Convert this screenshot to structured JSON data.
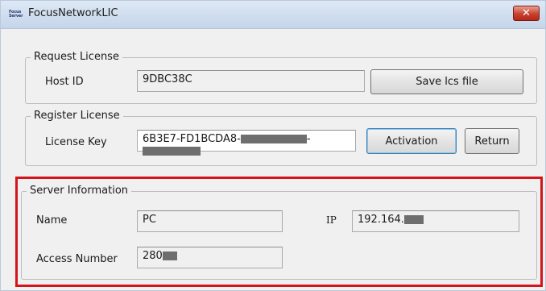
{
  "window": {
    "title": "FocusNetworkLIC",
    "app_icon_line1": "Focus",
    "app_icon_line2": "Server",
    "close_symbol": "✕"
  },
  "request_license": {
    "legend": "Request License",
    "host_id_label": "Host ID",
    "host_id_value": "9DBC38C",
    "save_button_label": "Save lcs file"
  },
  "register_license": {
    "legend": "Register License",
    "license_key_label": "License Key",
    "license_key_part1": "6B3E7-FD1BCDA8-",
    "license_key_separator": "-",
    "activation_button_label": "Activation",
    "return_button_label": "Return"
  },
  "server_information": {
    "legend": "Server Information",
    "name_label": "Name",
    "name_value": "PC",
    "ip_label": "IP",
    "ip_value": "192.164.",
    "access_number_label": "Access Number",
    "access_number_value": "280"
  },
  "colors": {
    "highlight_border": "#d4141b",
    "close_button": "#c9402e",
    "window_background": "#f0f0f0"
  }
}
